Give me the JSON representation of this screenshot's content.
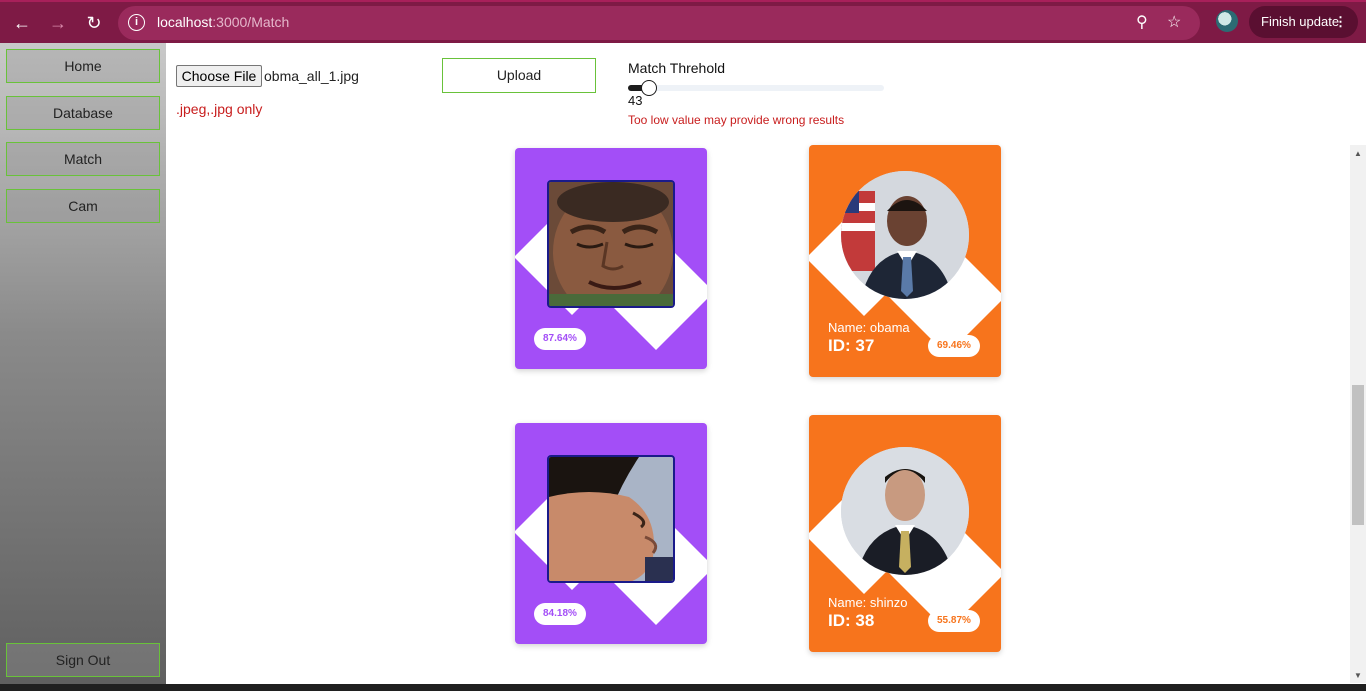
{
  "browser": {
    "url_host": "localhost",
    "url_path": ":3000/Match",
    "finish_update_label": "Finish update"
  },
  "sidebar": {
    "items": [
      {
        "label": "Home"
      },
      {
        "label": "Database"
      },
      {
        "label": "Match"
      },
      {
        "label": "Cam"
      }
    ],
    "sign_out_label": "Sign Out"
  },
  "upload": {
    "choose_file_label": "Choose File",
    "file_name": "obma_all_1.jpg",
    "format_hint": ".jpeg,.jpg only",
    "upload_label": "Upload"
  },
  "threshold": {
    "label": "Match Threhold",
    "value": "43",
    "fraction": 0.043,
    "warning": "Too low value may provide wrong results"
  },
  "results": [
    {
      "query_score": "87.64%",
      "match_name": "Name: obama",
      "match_id": "ID: 37",
      "match_score": "69.46%"
    },
    {
      "query_score": "84.18%",
      "match_name": "Name: shinzo",
      "match_id": "ID: 38",
      "match_score": "55.87%"
    }
  ],
  "colors": {
    "query_card": "#a34ef7",
    "match_card": "#f7741c",
    "warning": "#c81d1d",
    "chrome": "#7e1a45",
    "button_border": "#69c23a"
  }
}
